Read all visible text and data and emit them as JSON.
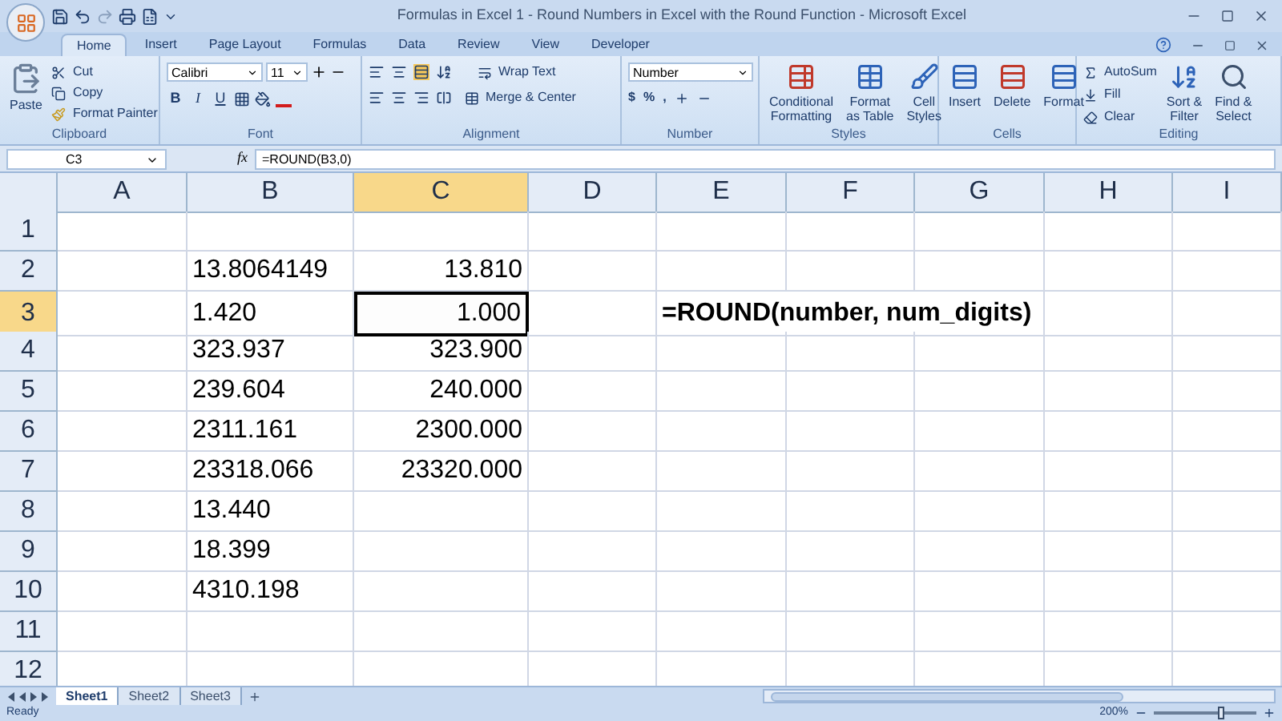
{
  "window": {
    "title": "Formulas in Excel 1 - Round Numbers in Excel with the Round Function - Microsoft Excel"
  },
  "tabs": [
    {
      "label": "Home",
      "selected": true
    },
    {
      "label": "Insert",
      "selected": false
    },
    {
      "label": "Page Layout",
      "selected": false
    },
    {
      "label": "Formulas",
      "selected": false
    },
    {
      "label": "Data",
      "selected": false
    },
    {
      "label": "Review",
      "selected": false
    },
    {
      "label": "View",
      "selected": false
    },
    {
      "label": "Developer",
      "selected": false
    }
  ],
  "ribbon": {
    "clipboard": {
      "name": "Clipboard",
      "paste": "Paste",
      "cut": "Cut",
      "copy": "Copy",
      "format_painter": "Format Painter"
    },
    "font": {
      "name": "Font",
      "font_name": "Calibri",
      "font_size": "11",
      "bold": "B",
      "italic": "I",
      "underline": "U"
    },
    "alignment": {
      "name": "Alignment",
      "wrap_text": "Wrap Text",
      "merge_center": "Merge & Center"
    },
    "number": {
      "name": "Number",
      "format": "Number",
      "currency": "$",
      "percent": "%",
      "comma": ","
    },
    "styles": {
      "name": "Styles",
      "buttons": [
        {
          "line1": "Conditional",
          "line2": "Formatting"
        },
        {
          "line1": "Format",
          "line2": "as Table"
        },
        {
          "line1": "Cell",
          "line2": "Styles"
        }
      ]
    },
    "cells": {
      "name": "Cells",
      "buttons": [
        "Insert",
        "Delete",
        "Format"
      ]
    },
    "editing": {
      "name": "Editing",
      "autosum": "AutoSum",
      "fill": "Fill",
      "clear": "Clear",
      "buttons": [
        {
          "line1": "Sort &",
          "line2": "Filter"
        },
        {
          "line1": "Find &",
          "line2": "Select"
        }
      ]
    }
  },
  "formula_bar": {
    "name_box": "C3",
    "fx": "fx",
    "formula": "=ROUND(B3,0)"
  },
  "columns": [
    {
      "label": "A",
      "selected": false
    },
    {
      "label": "B",
      "selected": false
    },
    {
      "label": "C",
      "selected": true
    },
    {
      "label": "D",
      "selected": false
    },
    {
      "label": "E",
      "selected": false
    },
    {
      "label": "F",
      "selected": false
    },
    {
      "label": "G",
      "selected": false
    },
    {
      "label": "H",
      "selected": false
    },
    {
      "label": "I",
      "selected": false
    }
  ],
  "rows": [
    {
      "label": "1",
      "selected": false,
      "cells": {}
    },
    {
      "label": "2",
      "selected": false,
      "cells": {
        "B": {
          "kind": "text",
          "text": "13.8064149",
          "active": false
        },
        "C": {
          "kind": "number",
          "text": "13.810",
          "active": false
        }
      }
    },
    {
      "label": "3",
      "selected": true,
      "cells": {
        "B": {
          "kind": "text",
          "text": "1.420",
          "active": false
        },
        "C": {
          "kind": "number",
          "text": "1.000",
          "active": true
        },
        "E": {
          "kind": "note",
          "text": "=ROUND(number, num_digits)",
          "active": false
        }
      }
    },
    {
      "label": "4",
      "selected": false,
      "cells": {
        "B": {
          "kind": "text",
          "text": "323.937",
          "active": false
        },
        "C": {
          "kind": "number",
          "text": "323.900",
          "active": false
        }
      }
    },
    {
      "label": "5",
      "selected": false,
      "cells": {
        "B": {
          "kind": "text",
          "text": "239.604",
          "active": false
        },
        "C": {
          "kind": "number",
          "text": "240.000",
          "active": false
        }
      }
    },
    {
      "label": "6",
      "selected": false,
      "cells": {
        "B": {
          "kind": "text",
          "text": "2311.161",
          "active": false
        },
        "C": {
          "kind": "number",
          "text": "2300.000",
          "active": false
        }
      }
    },
    {
      "label": "7",
      "selected": false,
      "cells": {
        "B": {
          "kind": "text",
          "text": "23318.066",
          "active": false
        },
        "C": {
          "kind": "number",
          "text": "23320.000",
          "active": false
        }
      }
    },
    {
      "label": "8",
      "selected": false,
      "cells": {
        "B": {
          "kind": "text",
          "text": "13.440",
          "active": false
        }
      }
    },
    {
      "label": "9",
      "selected": false,
      "cells": {
        "B": {
          "kind": "text",
          "text": "18.399",
          "active": false
        }
      }
    },
    {
      "label": "10",
      "selected": false,
      "cells": {
        "B": {
          "kind": "text",
          "text": "4310.198",
          "active": false
        }
      }
    },
    {
      "label": "11",
      "selected": false,
      "cells": {}
    },
    {
      "label": "12",
      "selected": false,
      "cells": {}
    }
  ],
  "sheets": [
    {
      "label": "Sheet1",
      "selected": true
    },
    {
      "label": "Sheet2",
      "selected": false
    },
    {
      "label": "Sheet3",
      "selected": false
    }
  ],
  "status_bar": {
    "status": "Ready",
    "zoom": "200%",
    "zoom_slider": {
      "level": 0.62
    }
  }
}
